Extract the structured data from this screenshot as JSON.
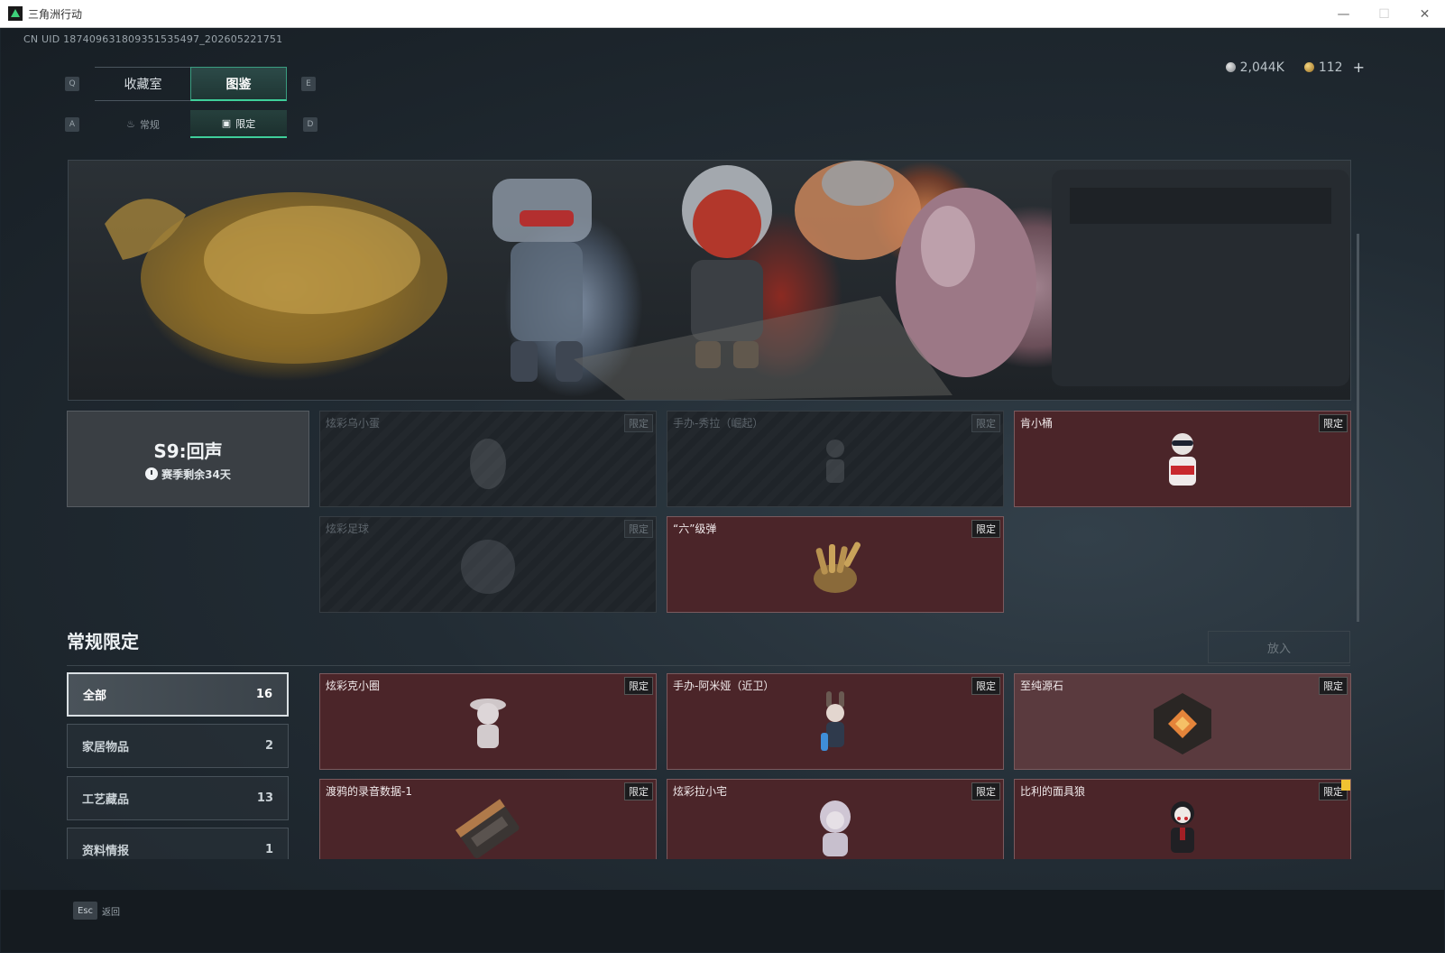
{
  "window": {
    "title": "三角洲行动",
    "min": "—",
    "max": "☐",
    "close": "✕"
  },
  "uid": "CN UID 187409631809351535497_202605221751",
  "currency": {
    "silver": "2,044K",
    "gold": "112",
    "plus": "+"
  },
  "tabs": {
    "prev_key": "Q",
    "next_key": "E",
    "main": [
      {
        "label": "收藏室",
        "active": false
      },
      {
        "label": "图鉴",
        "active": true
      }
    ],
    "sub_prev_key": "A",
    "sub_next_key": "D",
    "sub": [
      {
        "label": "常规",
        "icon": "flame-icon",
        "active": false
      },
      {
        "label": "限定",
        "icon": "image-icon",
        "active": true
      }
    ]
  },
  "season": {
    "title": "S9:回声",
    "remaining": "赛季剩余34天"
  },
  "season_items": [
    {
      "name": "炫彩乌小蛋",
      "badge": "限定",
      "owned": false,
      "icon": "egg-figure-icon"
    },
    {
      "name": "手办-秀拉（崛起）",
      "badge": "限定",
      "owned": false,
      "icon": "figure-icon"
    },
    {
      "name": "肯小桶",
      "badge": "限定",
      "owned": true,
      "icon": "bucket-figure-icon"
    },
    {
      "name": "炫彩足球",
      "badge": "限定",
      "owned": false,
      "icon": "football-icon"
    },
    {
      "name": "“六”级弹",
      "badge": "限定",
      "owned": true,
      "icon": "bullet-hand-icon"
    }
  ],
  "section": {
    "title": "常规限定",
    "place_button": "放入"
  },
  "filters": [
    {
      "label": "全部",
      "count": "16",
      "active": true
    },
    {
      "label": "家居物品",
      "count": "2",
      "active": false
    },
    {
      "label": "工艺藏品",
      "count": "13",
      "active": false
    },
    {
      "label": "资料情报",
      "count": "1",
      "active": false
    }
  ],
  "regular_items": [
    {
      "name": "炫彩克小圈",
      "badge": "限定",
      "icon": "hat-figure-icon"
    },
    {
      "name": "手办-阿米娅（近卫）",
      "badge": "限定",
      "icon": "amiya-figure-icon"
    },
    {
      "name": "至纯源石",
      "badge": "限定",
      "icon": "originium-icon"
    },
    {
      "name": "渡鸦的录音数据-1",
      "badge": "限定",
      "icon": "tape-icon"
    },
    {
      "name": "炫彩拉小宅",
      "badge": "限定",
      "icon": "hooded-figure-icon"
    },
    {
      "name": "比利的面具狼",
      "badge": "限定",
      "icon": "puppet-icon"
    }
  ],
  "footer": {
    "esc_key": "Esc",
    "esc_label": "返回"
  }
}
